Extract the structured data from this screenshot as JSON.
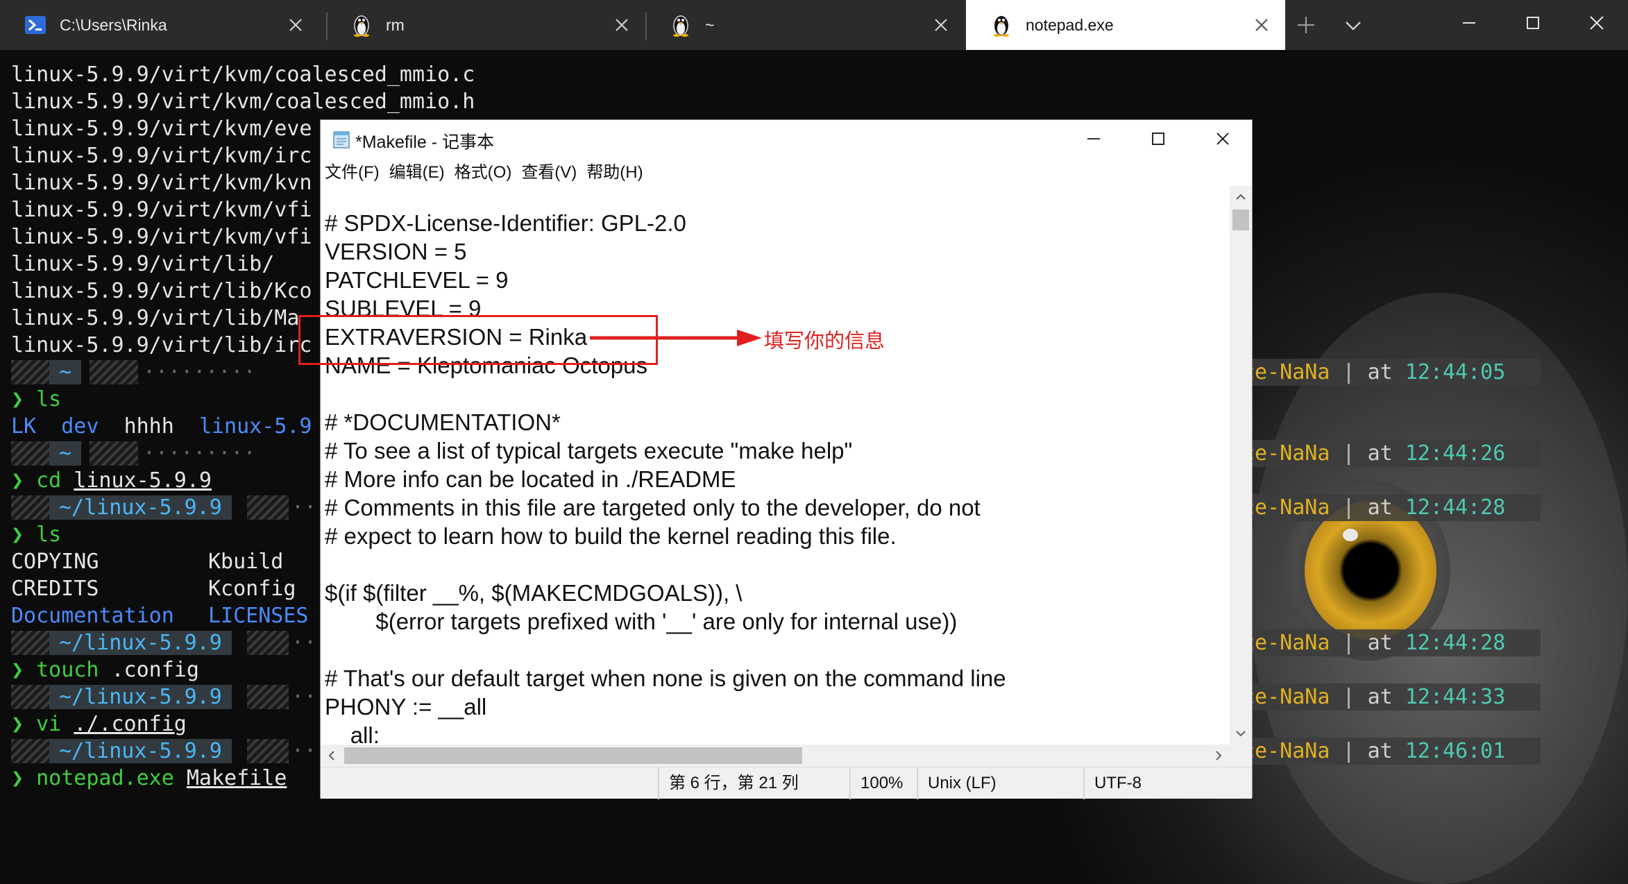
{
  "tabs": [
    {
      "label": "C:\\Users\\Rinka",
      "icon": "powershell-icon"
    },
    {
      "label": "rm",
      "icon": "linux-penguin-icon"
    },
    {
      "label": "~",
      "icon": "linux-penguin-icon"
    },
    {
      "label": "notepad.exe",
      "icon": "linux-penguin-icon"
    }
  ],
  "terminal": {
    "lines": [
      "linux-5.9.9/virt/kvm/coalesced_mmio.c",
      "linux-5.9.9/virt/kvm/coalesced_mmio.h",
      "linux-5.9.9/virt/kvm/eve",
      "linux-5.9.9/virt/kvm/irc",
      "linux-5.9.9/virt/kvm/kvn",
      "linux-5.9.9/virt/kvm/vfi",
      "linux-5.9.9/virt/kvm/vfi",
      "linux-5.9.9/virt/lib/",
      "linux-5.9.9/virt/lib/Kco",
      "linux-5.9.9/virt/lib/Ma",
      "linux-5.9.9/virt/lib/irc"
    ],
    "prompt_home": "~",
    "prompt_dir": "~/linux-5.9.9",
    "prompt_symbol": "❯",
    "cmd_ls": "ls",
    "ls_home": [
      "LK",
      "dev",
      "hhhh",
      "linux-5.9"
    ],
    "cmd_cd": "cd",
    "cmd_cd_arg": "linux-5.9.9",
    "ls_dir": [
      [
        "COPYING",
        "Kbuild"
      ],
      [
        "CREDITS",
        "Kconfig"
      ],
      [
        "Documentation",
        "LICENSES"
      ]
    ],
    "cmd_touch": "touch",
    "cmd_touch_arg": ".config",
    "cmd_vi": "vi",
    "cmd_vi_arg": "./.config",
    "cmd_notepad": "notepad.exe",
    "cmd_notepad_arg": "Makefile",
    "right_status": [
      {
        "name": "ce-NaNa",
        "at": "at",
        "time": "12:44:05"
      },
      {
        "name": "ce-NaNa",
        "at": "at",
        "time": "12:44:26"
      },
      {
        "name": "ce-NaNa",
        "at": "at",
        "time": "12:44:28"
      },
      {
        "name": "ce-NaNa",
        "at": "at",
        "time": "12:44:28"
      },
      {
        "name": "ce-NaNa",
        "at": "at",
        "time": "12:44:33"
      },
      {
        "name": "ce-NaNa",
        "at": "at",
        "time": "12:46:01"
      }
    ]
  },
  "notepad": {
    "title": "*Makefile - 记事本",
    "menu": [
      "文件(F)",
      "编辑(E)",
      "格式(O)",
      "查看(V)",
      "帮助(H)"
    ],
    "lines": [
      "# SPDX-License-Identifier: GPL-2.0",
      "VERSION = 5",
      "PATCHLEVEL = 9",
      "SUBLEVEL = 9",
      "EXTRAVERSION = Rinka",
      "NAME = Kleptomaniac Octopus",
      "",
      "# *DOCUMENTATION*",
      "# To see a list of typical targets execute \"make help\"",
      "# More info can be located in ./README",
      "# Comments in this file are targeted only to the developer, do not",
      "# expect to learn how to build the kernel reading this file.",
      "",
      "$(if $(filter __%, $(MAKECMDGOALS)), \\",
      "\t$(error targets prefixed with '__' are only for internal use))",
      "",
      "# That's our default target when none is given on the command line",
      "PHONY := __all",
      "__all:"
    ],
    "status": {
      "position": "第 6 行，第 21 列",
      "zoom": "100%",
      "line_ending": "Unix (LF)",
      "encoding": "UTF-8"
    }
  },
  "annotation": {
    "text": "填写你的信息",
    "color": "#e02020"
  }
}
